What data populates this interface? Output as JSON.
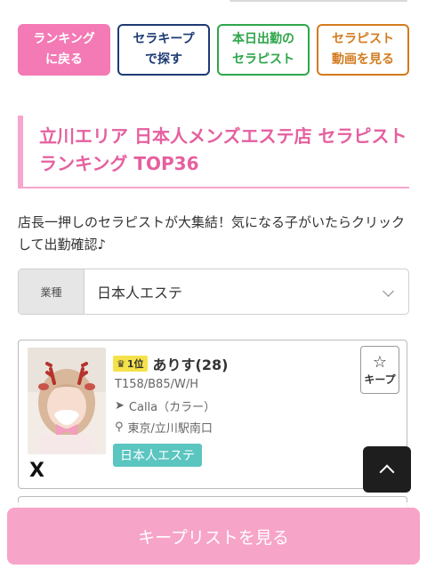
{
  "nav_buttons": [
    {
      "label": "ランキング\nに戻る",
      "style": "pink"
    },
    {
      "label": "セラキープ\nで探す",
      "style": "navy"
    },
    {
      "label": "本日出勤の\nセラピスト",
      "style": "green"
    },
    {
      "label": "セラピスト\n動画を見る",
      "style": "orange"
    }
  ],
  "heading": "立川エリア 日本人メンズエステ店 セラピストランキング TOP36",
  "description": "店長一押しのセラピストが大集結！気になる子がいたらクリックして出勤確認♪",
  "filter": {
    "label": "業種",
    "value": "日本人エステ"
  },
  "therapist": {
    "rank": "1位",
    "name": "ありす(28)",
    "spec": "T158/B85/W/H",
    "shop": "Calla（カラー）",
    "location": "東京/立川駅南口",
    "tag": "日本人エステ",
    "keep_label": "キープ",
    "social": "X"
  },
  "keep_list_button": "キープリストを見る",
  "colors": {
    "pink": "#f37ab5",
    "heading_pink": "#e5609f",
    "navy": "#1d3a74",
    "green": "#2ea64a",
    "orange": "#d27b1f",
    "teal_tag": "#5bc5c0",
    "rank_yellow": "#f5e24a"
  },
  "icons": [
    "crown-icon",
    "star-icon",
    "send-icon",
    "map-pin-icon",
    "x-logo-icon",
    "chevron-down-icon",
    "chevron-up-icon"
  ]
}
